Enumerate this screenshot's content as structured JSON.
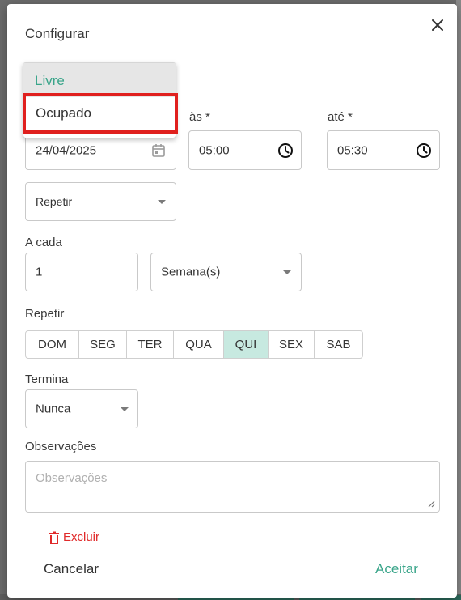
{
  "dialog": {
    "title": "Configurar",
    "status_menu": {
      "options": [
        "Livre",
        "Ocupado"
      ],
      "highlighted": "Livre"
    },
    "date_field": {
      "value": "24/04/2025"
    },
    "start_time": {
      "label": "às *",
      "value": "05:00"
    },
    "end_time": {
      "label": "até *",
      "value": "05:30"
    },
    "repeat_select": {
      "value": "Repetir"
    },
    "interval": {
      "label": "A cada",
      "value": "1",
      "unit": "Semana(s)"
    },
    "weekdays": {
      "label": "Repetir",
      "days": [
        "DOM",
        "SEG",
        "TER",
        "QUA",
        "QUI",
        "SEX",
        "SAB"
      ],
      "selected": "QUI"
    },
    "ends": {
      "label": "Termina",
      "value": "Nunca"
    },
    "notes": {
      "label": "Observações",
      "placeholder": "Observações"
    },
    "actions": {
      "delete": "Excluir",
      "cancel": "Cancelar",
      "accept": "Aceitar"
    }
  },
  "colors": {
    "accent": "#3aa58a",
    "selected_day_bg": "#c7e9e0",
    "delete": "#e02a2a",
    "highlight_box": "#e0201e"
  }
}
